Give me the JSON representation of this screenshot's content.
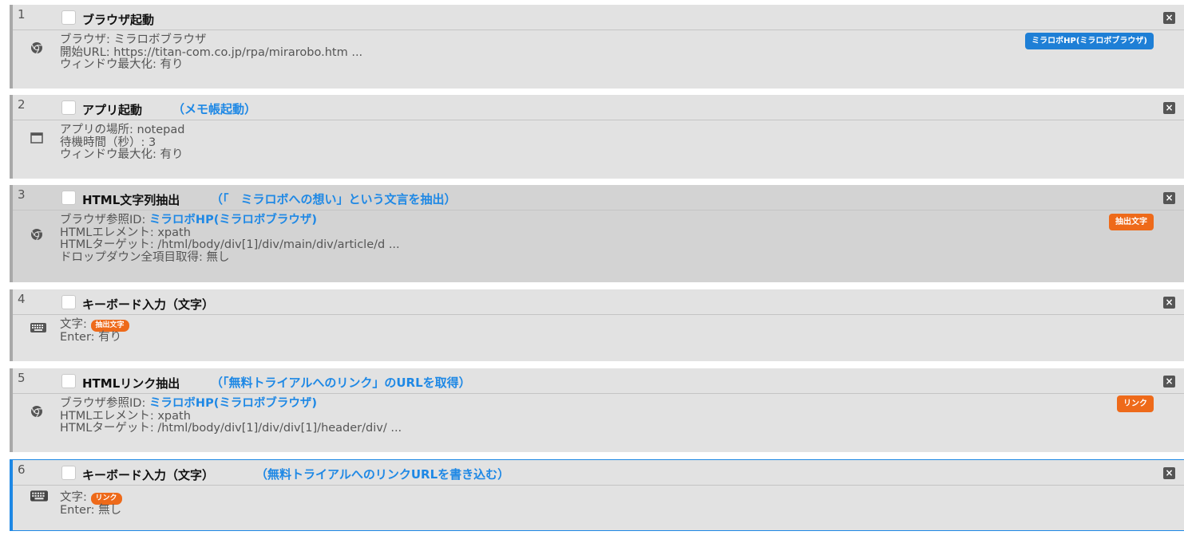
{
  "steps": [
    {
      "num": "1",
      "title": "ブラウザ起動",
      "comment": "",
      "icon": "chrome-icon",
      "rows": [
        {
          "label": "ブラウザ: ",
          "value": "ミラロボブラウザ"
        },
        {
          "label": "開始URL: ",
          "value": "https://titan-com.co.jp/rpa/mirarobo.htm ..."
        },
        {
          "label": "ウィンドウ最大化: ",
          "value": "有り"
        }
      ],
      "badge": "ミラロボHP(ミラロボブラウザ)"
    },
    {
      "num": "2",
      "title": "アプリ起動",
      "comment": "（メモ帳起動）",
      "icon": "window-icon",
      "rows": [
        {
          "label": "アプリの場所: ",
          "value": "notepad"
        },
        {
          "label": "待機時間（秒）: ",
          "value": "3"
        },
        {
          "label": "ウィンドウ最大化: ",
          "value": "有り"
        }
      ]
    },
    {
      "num": "3",
      "title": "HTML文字列抽出",
      "comment": "（「　ミラロボへの想い」という文言を抽出）",
      "icon": "chrome-icon",
      "rows": [
        {
          "label": "ブラウザ参照ID: ",
          "link": "ミラロボHP(ミラロボブラウザ)"
        },
        {
          "label": "HTMLエレメント: ",
          "value": "xpath"
        },
        {
          "label": "HTMLターゲット: ",
          "value": "/html/body/div[1]/div/main/div/article/d ..."
        },
        {
          "label": "ドロップダウン全項目取得: ",
          "value": "無し"
        }
      ],
      "badge": "抽出文字"
    },
    {
      "num": "4",
      "title": "キーボード入力（文字）",
      "comment": "",
      "icon": "keyboard-icon",
      "rows": [
        {
          "label": "文字: ",
          "tag": "抽出文字"
        },
        {
          "label": "Enter: ",
          "value": "有り"
        }
      ]
    },
    {
      "num": "5",
      "title": "HTMLリンク抽出",
      "comment": "（「無料トライアルへのリンク」のURLを取得）",
      "icon": "chrome-icon",
      "rows": [
        {
          "label": "ブラウザ参照ID: ",
          "link": "ミラロボHP(ミラロボブラウザ)"
        },
        {
          "label": "HTMLエレメント: ",
          "value": "xpath"
        },
        {
          "label": "HTMLターゲット: ",
          "value": "/html/body/div[1]/div/div[1]/header/div/ ..."
        }
      ],
      "badge": "リンク"
    },
    {
      "num": "6",
      "title": "キーボード入力（文字）",
      "comment": "（無料トライアルへのリンクURLを書き込む）",
      "icon": "keyboard-icon",
      "rows": [
        {
          "label": "文字: ",
          "tag": "リンク"
        },
        {
          "label": "Enter: ",
          "value": "無し"
        }
      ]
    }
  ],
  "colors": {
    "accent": "#1e88e5",
    "badge_blue": "#1e7fd6",
    "badge_orange": "#ee6a1a"
  },
  "close_icon": "×"
}
